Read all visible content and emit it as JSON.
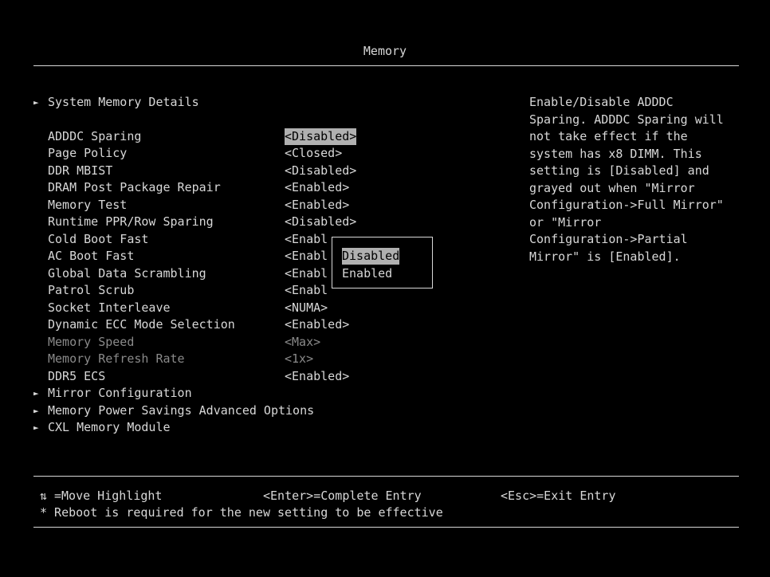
{
  "header": {
    "title": "Memory"
  },
  "menu": {
    "submenu_top": "System Memory Details",
    "items": [
      {
        "label": "ADDDC Sparing",
        "value": "<Disabled>"
      },
      {
        "label": "Page Policy",
        "value": "<Closed>"
      },
      {
        "label": "DDR MBIST",
        "value": "<Disabled>"
      },
      {
        "label": "DRAM Post Package Repair",
        "value": "<Enabled>"
      },
      {
        "label": "Memory Test",
        "value": "<Enabled>"
      },
      {
        "label": "Runtime PPR/Row Sparing",
        "value": "<Disabled>"
      },
      {
        "label": "Cold Boot Fast",
        "value": "<Enabl"
      },
      {
        "label": "AC Boot Fast",
        "value": "<Enabl"
      },
      {
        "label": "Global Data Scrambling",
        "value": "<Enabl"
      },
      {
        "label": "Patrol Scrub",
        "value": "<Enabl"
      },
      {
        "label": "Socket Interleave",
        "value": "<NUMA>"
      },
      {
        "label": "Dynamic ECC Mode Selection",
        "value": "<Enabled>"
      },
      {
        "label": "Memory Speed",
        "value": "<Max>"
      },
      {
        "label": "Memory Refresh Rate",
        "value": "<1x>"
      },
      {
        "label": "DDR5 ECS",
        "value": "<Enabled>"
      }
    ],
    "submenus": [
      "Mirror Configuration",
      "Memory Power Savings Advanced Options",
      "CXL Memory Module"
    ]
  },
  "popup": {
    "options": [
      "Disabled",
      "Enabled"
    ]
  },
  "help": {
    "lines": [
      "Enable/Disable ADDDC",
      "Sparing. ADDDC Sparing will",
      "not take effect if the",
      "system has x8 DIMM. This",
      "setting is [Disabled] and",
      "grayed out when \"Mirror",
      "Configuration->Full Mirror\"",
      "or \"Mirror",
      "Configuration->Partial",
      "Mirror\" is [Enabled]."
    ]
  },
  "footer": {
    "move": "=Move Highlight",
    "enter": "<Enter>=Complete Entry",
    "esc": "<Esc>=Exit Entry",
    "reboot": "* Reboot is required for the new setting to be effective"
  },
  "icons": {
    "submenu": "triangle-right-icon",
    "updown": "up-down-arrows-icon"
  },
  "colors": {
    "background": "#000000",
    "text": "#d8d8d8",
    "disabled": "#8a8a8a",
    "highlight": "#b0b0b0"
  }
}
